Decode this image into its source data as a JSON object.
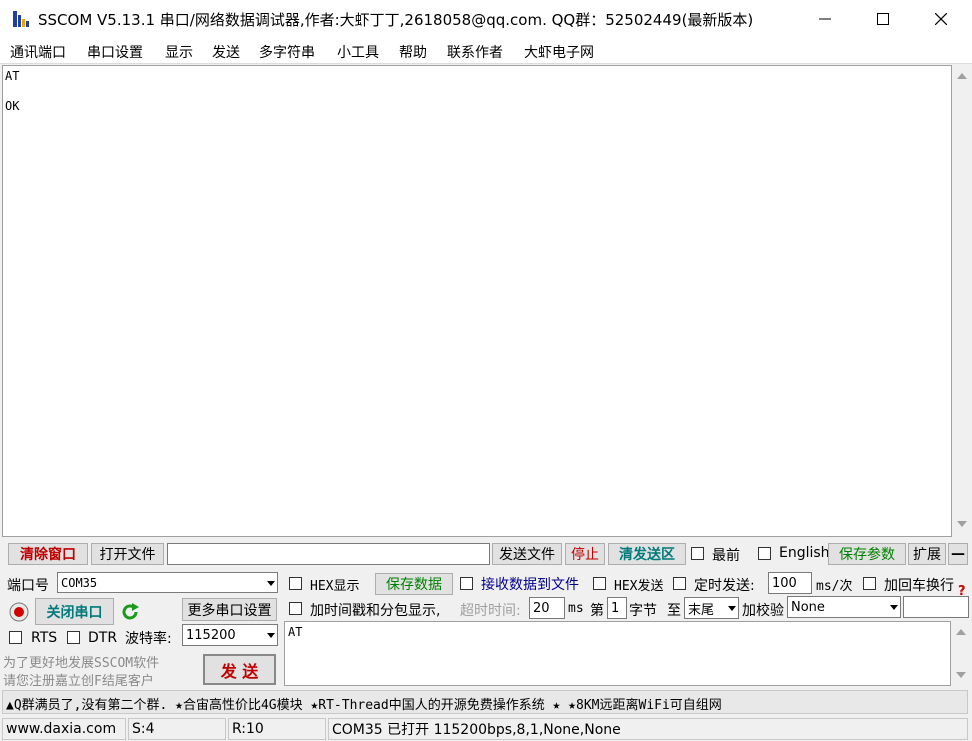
{
  "window": {
    "title": "SSCOM V5.13.1 串口/网络数据调试器,作者:大虾丁丁,2618058@qq.com. QQ群：52502449(最新版本)"
  },
  "menu": [
    "通讯端口",
    "串口设置",
    "显示",
    "发送",
    "多字符串",
    "小工具",
    "帮助",
    "联系作者",
    "大虾电子网"
  ],
  "receive": {
    "lines": [
      "AT",
      "OK"
    ]
  },
  "toolbar": {
    "clear_window": "清除窗口",
    "open_file": "打开文件",
    "file_path": "",
    "send_file": "发送文件",
    "stop": "停止",
    "clear_send": "清发送区",
    "topmost": "最前",
    "english": "English",
    "save_params": "保存参数",
    "expand": "扩展",
    "collapse": "—"
  },
  "port": {
    "label": "端口号",
    "value": "COM35",
    "close_port": "关闭串口",
    "more_settings": "更多串口设置",
    "rts": "RTS",
    "dtr": "DTR",
    "baud_label": "波特率:",
    "baud_value": "115200"
  },
  "options": {
    "hex_display": "HEX显示",
    "save_data": "保存数据",
    "recv_to_file": "接收数据到文件",
    "hex_send": "HEX发送",
    "timed_send": "定时发送:",
    "interval": "100",
    "interval_unit": "ms/次",
    "add_crlf": "加回车换行",
    "add_timestamp": "加时间戳和分包显示,",
    "timeout_label": "超时时间:",
    "timeout_value": "20",
    "timeout_unit": "ms",
    "byte_prefix": "第",
    "byte_index": "1",
    "byte_suffix": "字节",
    "to_label": "至",
    "to_value": "末尾",
    "checksum_label": "加校验",
    "checksum_value": "None",
    "help_mark": "?"
  },
  "send": {
    "text": "AT",
    "button": "发  送"
  },
  "promo": {
    "line1": "为了更好地发展SSCOM软件",
    "line2": "请您注册嘉立创F结尾客户"
  },
  "ticker": "▲Q群满员了,没有第二个群. ★合宙高性价比4G模块 ★RT-Thread中国人的开源免费操作系统 ★ ★8KM远距离WiFi可自组网",
  "status": {
    "site": "www.daxia.com",
    "sent": "S:4",
    "received": "R:10",
    "port_state": "COM35 已打开  115200bps,8,1,None,None"
  }
}
